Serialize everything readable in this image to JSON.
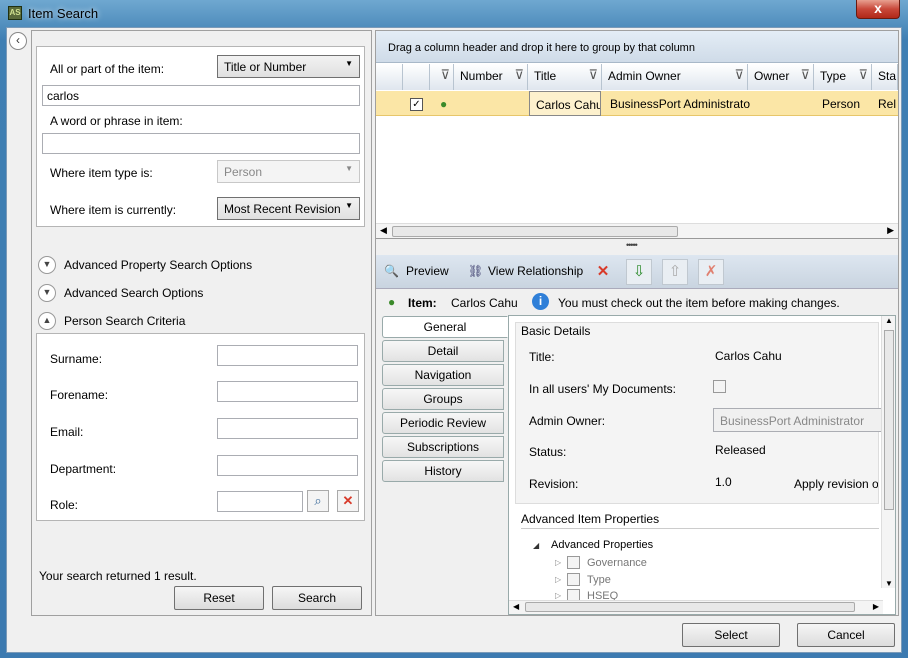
{
  "window": {
    "title": "Item Search",
    "app_icon": "AS",
    "close_label": "x"
  },
  "search": {
    "part_label": "All or part of the item:",
    "part_mode": "Title or Number",
    "part_value": "carlos",
    "word_label": "A word or phrase in item:",
    "word_value": "",
    "type_label": "Where item type is:",
    "type_value": "Person",
    "current_label": "Where item is currently:",
    "current_value": "Most Recent Revision"
  },
  "sections": {
    "advanced_property": "Advanced Property Search Options",
    "advanced_search": "Advanced Search Options",
    "person_criteria": "Person Search Criteria"
  },
  "person": {
    "surname": "Surname:",
    "forename": "Forename:",
    "email": "Email:",
    "department": "Department:",
    "role": "Role:"
  },
  "result_text": "Your search returned 1 result.",
  "buttons": {
    "reset": "Reset",
    "search": "Search",
    "select": "Select",
    "cancel": "Cancel"
  },
  "grid": {
    "group_hint": "Drag a column header and drop it here to group by that column",
    "columns": [
      "Number",
      "Title",
      "Admin Owner",
      "Owner",
      "Type",
      "Sta"
    ],
    "row": {
      "checked": true,
      "number": "",
      "title": "Carlos Cahu",
      "admin_owner": "BusinessPort Administrator",
      "owner": "",
      "type": "Person",
      "status": "Rel"
    }
  },
  "toolbar": {
    "preview": "Preview",
    "view_relationship": "View Relationship"
  },
  "info": {
    "item_label": "Item:",
    "item_value": "Carlos Cahu",
    "message": "You must check out the item before making changes."
  },
  "tabs": [
    "General",
    "Detail",
    "Navigation",
    "Groups",
    "Periodic Review",
    "Subscriptions",
    "History"
  ],
  "details": {
    "basic_title": "Basic Details",
    "title_label": "Title:",
    "title_value": "Carlos Cahu",
    "docs_label": "In all users' My Documents:",
    "admin_label": "Admin Owner:",
    "admin_value": "BusinessPort Administrator",
    "status_label": "Status:",
    "status_value": "Released",
    "revision_label": "Revision:",
    "revision_value": "1.0",
    "revision_apply": "Apply revision of",
    "advanced_title": "Advanced Item Properties",
    "advanced_root": "Advanced Properties",
    "tree_items": [
      "Governance",
      "Type",
      "HSEQ"
    ]
  },
  "colors": {
    "selected_row": "#fbe6a6",
    "delete_red": "#d83a2a",
    "title_bar": "#3c7ab0"
  }
}
